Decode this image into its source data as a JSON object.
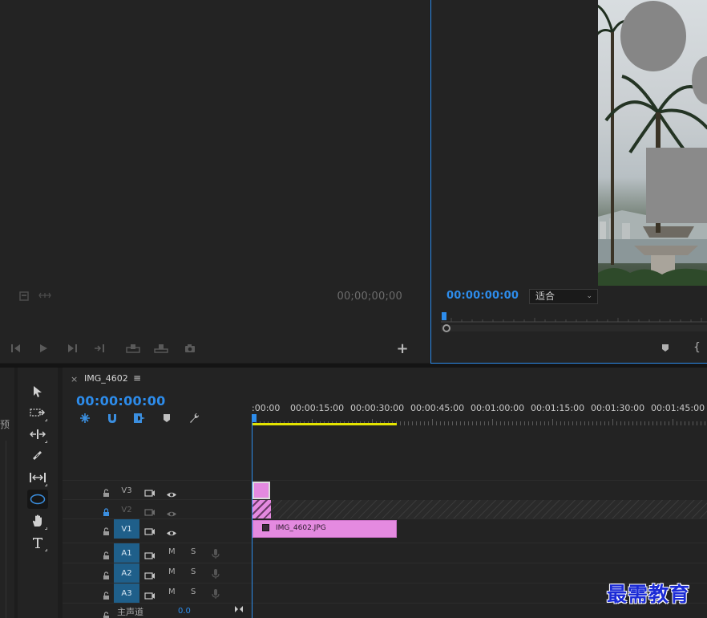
{
  "source_monitor": {
    "timecode": "00;00;00;00"
  },
  "program_monitor": {
    "timecode": "00:00:00:00",
    "fit": "适合"
  },
  "project_panel": {
    "label_char": "预"
  },
  "timeline": {
    "tab_title": "IMG_4602",
    "timecode": "00:00:00:00",
    "ruler_labels": [
      ":00:00",
      "00:00:15:00",
      "00:00:30:00",
      "00:00:45:00",
      "00:01:00:00",
      "00:01:15:00",
      "00:01:30:00",
      "00:01:45:00"
    ],
    "video_tracks": [
      {
        "name": "V3"
      },
      {
        "name": "V2"
      },
      {
        "name": "V1"
      }
    ],
    "audio_tracks": [
      {
        "name": "A1",
        "mute": "M",
        "solo": "S"
      },
      {
        "name": "A2",
        "mute": "M",
        "solo": "S"
      },
      {
        "name": "A3",
        "mute": "M",
        "solo": "S"
      }
    ],
    "master": {
      "label": "主声道",
      "value": "0.0"
    },
    "clip": {
      "name": "IMG_4602.JPG",
      "color": "#e48ae0"
    }
  },
  "colors": {
    "accent": "#2d8ceb",
    "work_area": "#e4e400",
    "selected_track": "#1f5f8a"
  },
  "watermark": "最需教育"
}
